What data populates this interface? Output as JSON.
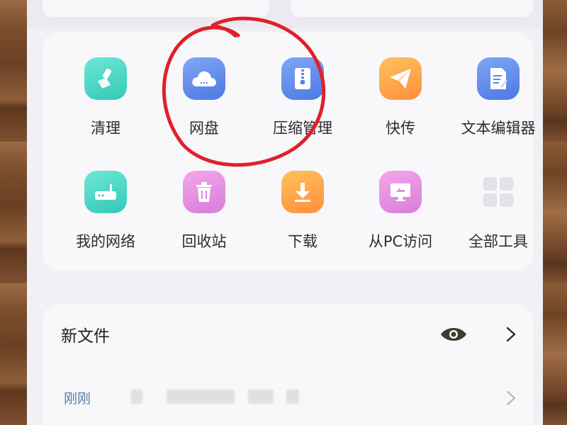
{
  "tools": [
    {
      "id": "clean",
      "label": "清理",
      "icon": "broom-icon",
      "color": "#3fd3c0"
    },
    {
      "id": "cloud",
      "label": "网盘",
      "icon": "cloud-icon",
      "color": "#5b86ea"
    },
    {
      "id": "zip",
      "label": "压缩管理",
      "icon": "zip-icon",
      "color": "#5b86ea"
    },
    {
      "id": "share",
      "label": "快传",
      "icon": "paper-plane-icon",
      "color": "#ffa545"
    },
    {
      "id": "editor",
      "label": "文本编辑器",
      "icon": "document-edit-icon",
      "color": "#5b86ea"
    },
    {
      "id": "network",
      "label": "我的网络",
      "icon": "router-icon",
      "color": "#3fd3c0"
    },
    {
      "id": "trash",
      "label": "回收站",
      "icon": "trash-icon",
      "color": "#e08be0"
    },
    {
      "id": "download",
      "label": "下载",
      "icon": "download-icon",
      "color": "#ffa545"
    },
    {
      "id": "pc",
      "label": "从PC访问",
      "icon": "monitor-icon",
      "color": "#e08be0"
    },
    {
      "id": "all",
      "label": "全部工具",
      "icon": "grid-icon",
      "color": "#e3e2e6"
    }
  ],
  "files": {
    "title": "新文件",
    "recent_label": "刚刚"
  },
  "annotation": {
    "color": "#e0202a",
    "target": "网盘"
  }
}
